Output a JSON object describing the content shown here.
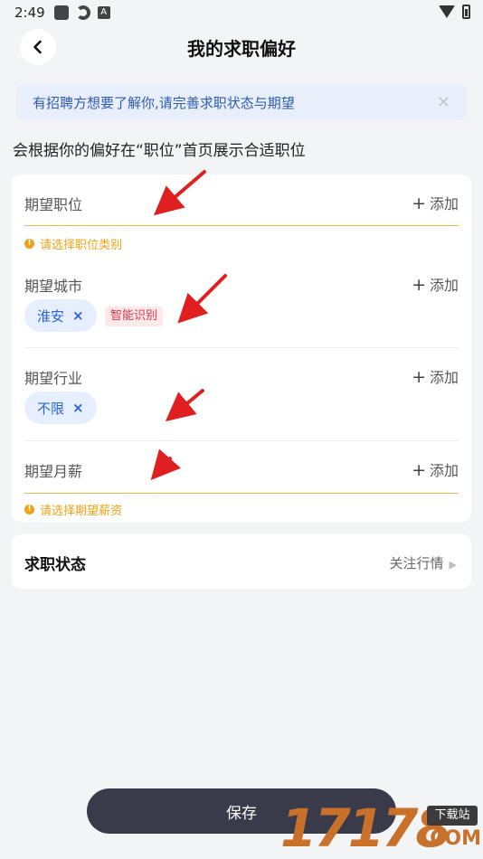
{
  "status_bar": {
    "time": "2:49",
    "a_badge": "A"
  },
  "nav": {
    "back_icon": "chevron-left-icon",
    "title": "我的求职偏好"
  },
  "notice": {
    "text": "有招聘方想要了解你,请完善求职状态与期望",
    "close": "×"
  },
  "hint": "会根据你的偏好在“职位”首页展示合适职位",
  "preferences": {
    "position": {
      "label": "期望职位",
      "add": "添加",
      "warning": "请选择职位类别"
    },
    "city": {
      "label": "期望城市",
      "add": "添加",
      "tag": "淮安",
      "tag_remove": "×",
      "smart_badge": "智能识别"
    },
    "industry": {
      "label": "期望行业",
      "add": "添加",
      "tag": "不限",
      "tag_remove": "×"
    },
    "salary": {
      "label": "期望月薪",
      "add": "添加",
      "warning": "请选择期望薪资"
    }
  },
  "job_status": {
    "label": "求职状态",
    "value": "关注行情"
  },
  "save_button": "保存",
  "watermark": {
    "number": "17178",
    "badge": "下载站",
    "suffix": ".COM"
  },
  "colors": {
    "warning": "#f0a214",
    "tag_bg": "#e6efff",
    "tag_text": "#2762d8",
    "smart_badge": "#d9384b",
    "save_bg": "#3a3b4a",
    "annotation_arrow": "#e02020"
  }
}
